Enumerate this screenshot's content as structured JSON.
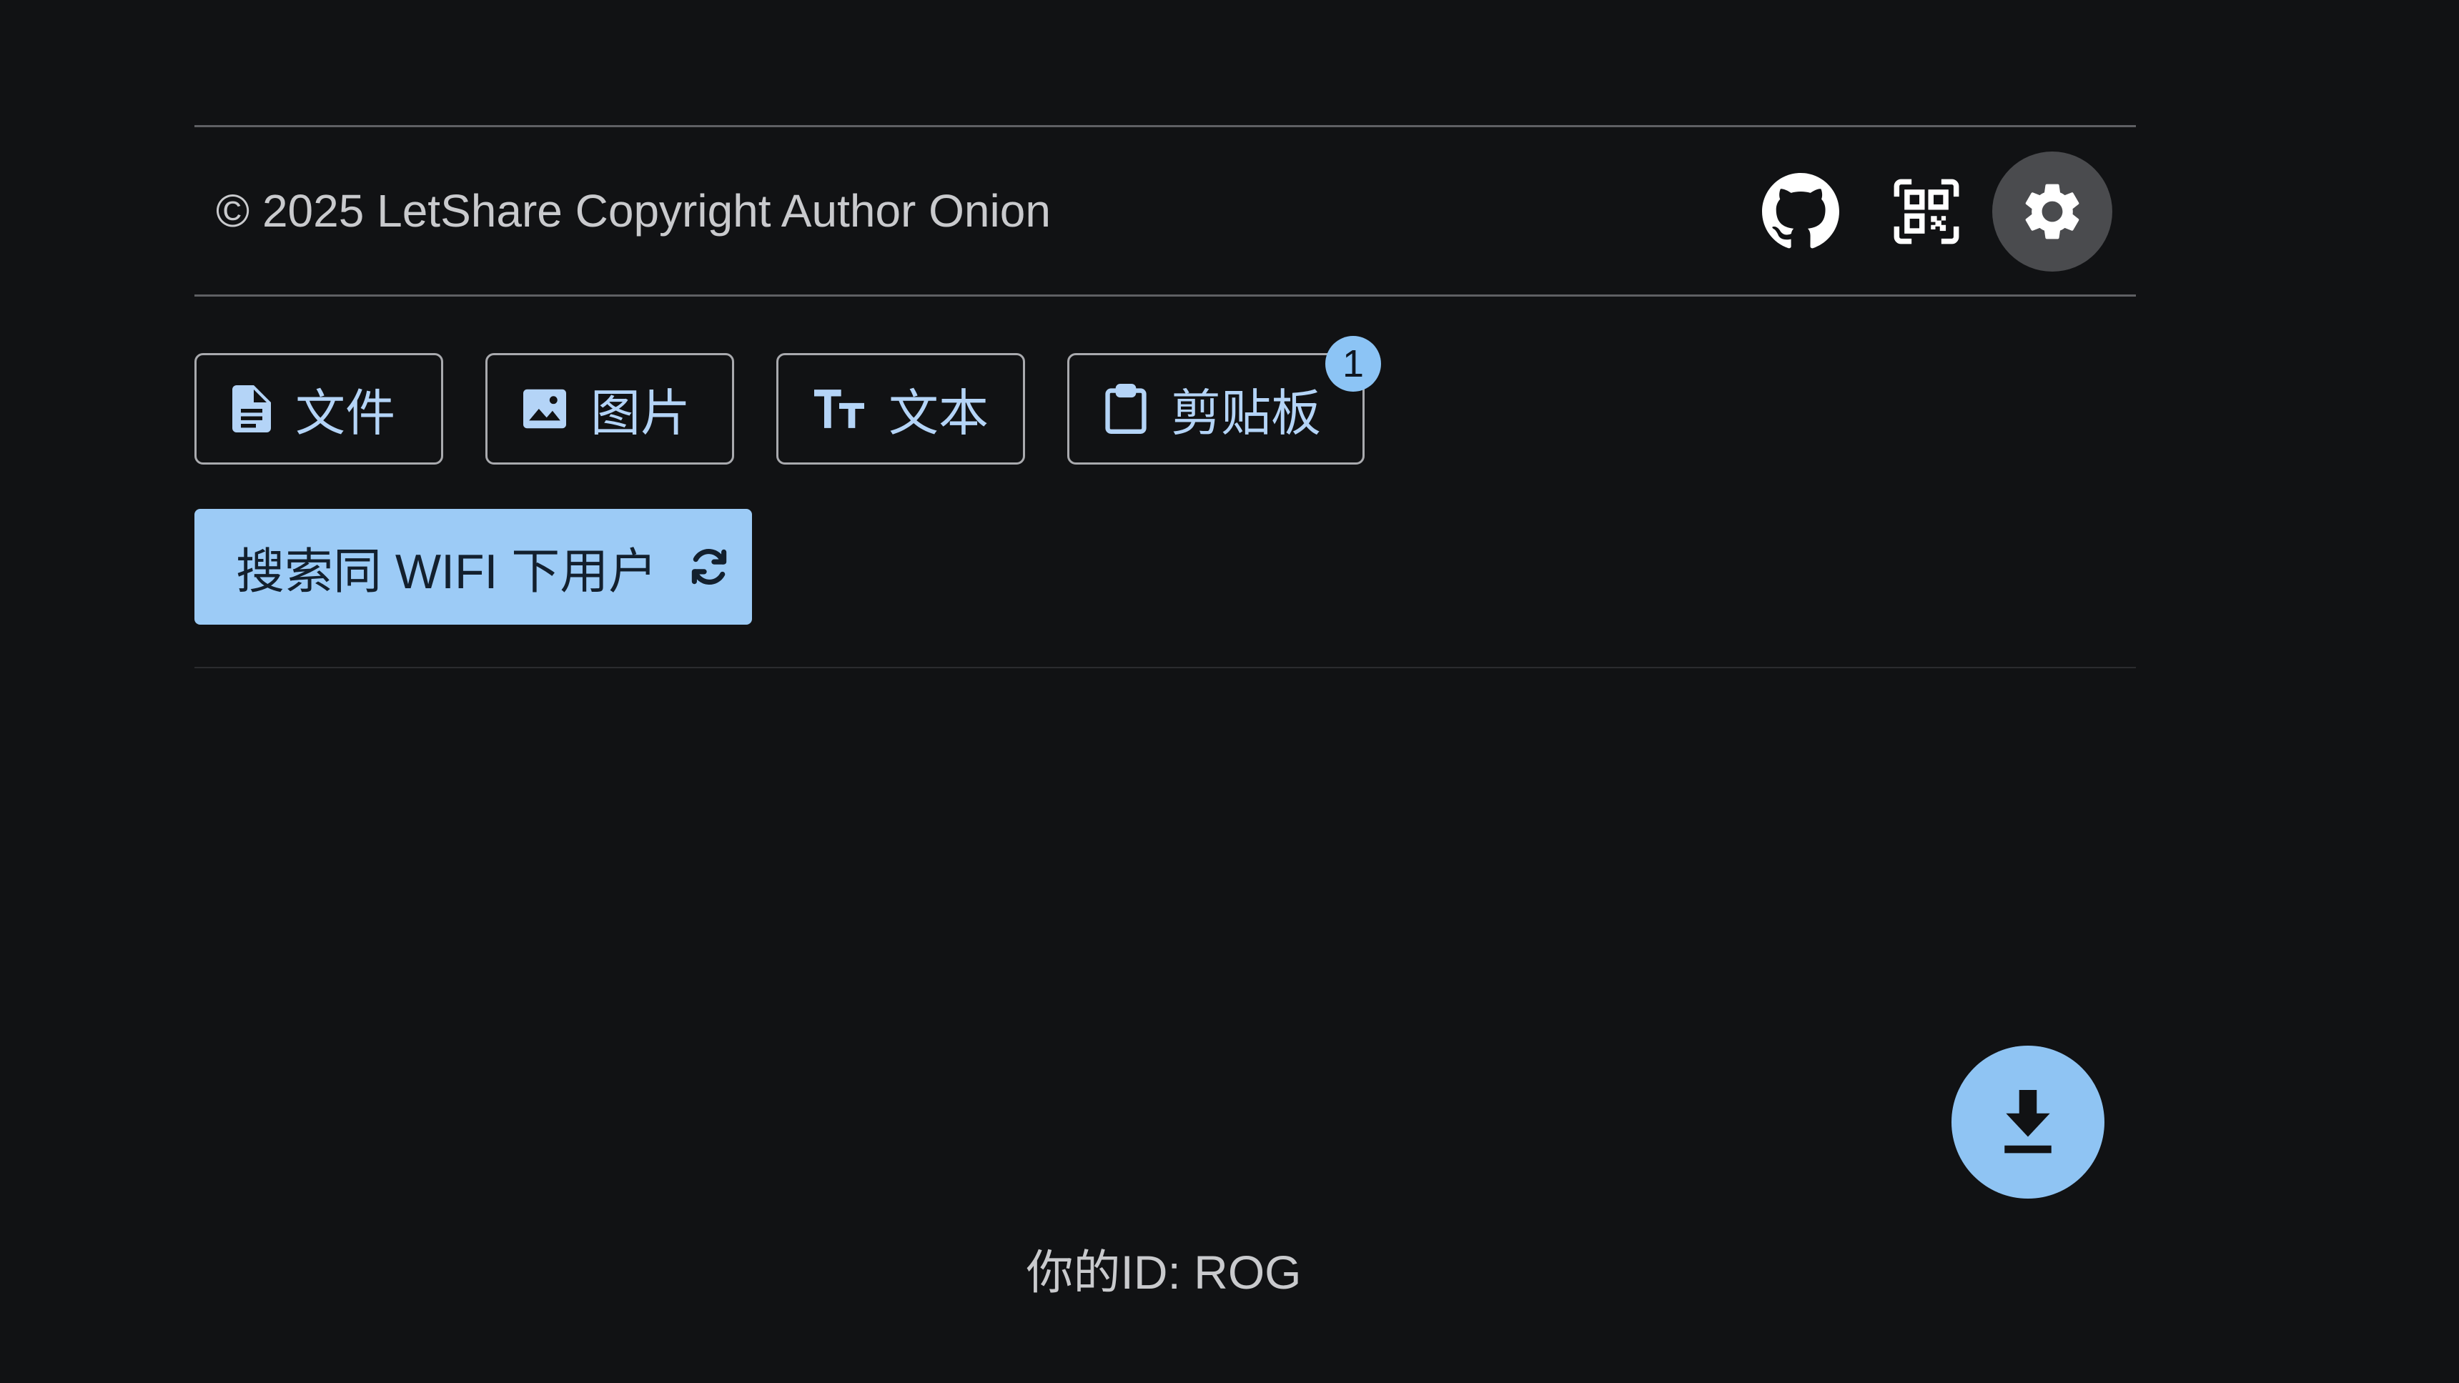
{
  "footer": {
    "copyright": "© 2025 LetShare Copyright Author Onion"
  },
  "header_icons": {
    "github": "github-icon",
    "qr": "qr-code-icon",
    "settings": "gear-icon"
  },
  "share_types": [
    {
      "label": "文件",
      "icon": "file-icon"
    },
    {
      "label": "图片",
      "icon": "image-icon"
    },
    {
      "label": "文本",
      "icon": "text-size-icon"
    },
    {
      "label": "剪贴板",
      "icon": "clipboard-icon"
    }
  ],
  "clipboard_badge": "1",
  "search": {
    "label": "搜索同 WIFI 下用户",
    "icon": "refresh-icon"
  },
  "fab": {
    "icon": "download-icon"
  },
  "user": {
    "id_text": "你的ID: ROG"
  },
  "colors": {
    "background": "#111214",
    "accent": "#9ccbf6",
    "accent_text": "#b4d4f7",
    "muted_text": "#c9cacd"
  }
}
